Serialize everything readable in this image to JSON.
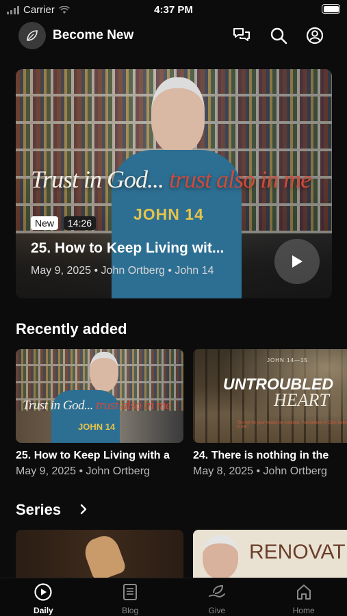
{
  "status_bar": {
    "carrier": "Carrier",
    "time": "4:37 PM"
  },
  "header": {
    "title": "Become New",
    "icons": [
      "chat-icon",
      "search-icon",
      "account-icon"
    ]
  },
  "hero": {
    "quote_part1": "Trust in God...",
    "quote_part2": "trust also in me",
    "overlay_title": "JOHN 14",
    "badge_new": "New",
    "duration": "14:26",
    "title": "25. How to Keep Living wit...",
    "meta": "May 9, 2025 • John Ortberg • John 14"
  },
  "recently_added": {
    "heading": "Recently added",
    "items": [
      {
        "thumb_quote_part1": "Trust in God...",
        "thumb_quote_part2": "trust also in me",
        "thumb_title": "JOHN 14",
        "title": "25. How to Keep Living with a",
        "meta": "May 9, 2025 • John Ortberg"
      },
      {
        "thumb_small": "JOHN 14—15",
        "thumb_big": "UNTROUBLED",
        "thumb_script": "HEART",
        "thumb_verse": "\"Do not let your hearts be troubled. You believe in God; believe also in me\"",
        "title": "24. There is nothing in the",
        "meta": "May 8, 2025 • John Ortberg"
      }
    ]
  },
  "series": {
    "heading": "Series",
    "items": [
      {
        "thumb_text": ""
      },
      {
        "thumb_text": "RENOVATION"
      }
    ]
  },
  "tab_bar": {
    "tabs": [
      {
        "label": "Daily",
        "icon": "play-circle-icon",
        "active": true
      },
      {
        "label": "Blog",
        "icon": "document-icon",
        "active": false
      },
      {
        "label": "Give",
        "icon": "leaf-hand-icon",
        "active": false
      },
      {
        "label": "Home",
        "icon": "home-icon",
        "active": false
      }
    ]
  },
  "colors": {
    "background": "#0c0c0c",
    "accent_red": "#d04a3a",
    "accent_gold": "#e6c44a",
    "series_blue": "#2d6f93"
  }
}
